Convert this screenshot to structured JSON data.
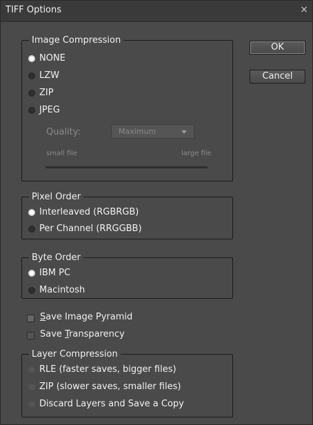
{
  "window": {
    "title": "TIFF Options",
    "close_glyph": "×"
  },
  "buttons": {
    "ok": "OK",
    "cancel": "Cancel"
  },
  "image_compression": {
    "legend": "Image Compression",
    "options": [
      "NONE",
      "LZW",
      "ZIP",
      "JPEG"
    ],
    "selected": "NONE",
    "quality_label": "Quality:",
    "quality_value": "Maximum",
    "small_file_label": "small file",
    "large_file_label": "large file"
  },
  "pixel_order": {
    "legend": "Pixel Order",
    "options": [
      "Interleaved (RGBRGB)",
      "Per Channel (RRGGBB)"
    ],
    "selected": "Interleaved (RGBRGB)"
  },
  "byte_order": {
    "legend": "Byte Order",
    "options": [
      "IBM PC",
      "Macintosh"
    ],
    "selected": "IBM PC"
  },
  "checkboxes": {
    "save_image_pyramid": {
      "mnemonic": "S",
      "rest": "ave Image Pyramid",
      "checked": false
    },
    "save_transparency": {
      "prefix": "Save ",
      "mnemonic": "T",
      "rest": "ransparency",
      "checked": false,
      "disabled": true
    }
  },
  "layer_compression": {
    "legend": "Layer Compression",
    "options": [
      "RLE (faster saves, bigger files)",
      "ZIP (slower saves, smaller files)",
      "Discard Layers and Save a Copy"
    ],
    "disabled": true
  },
  "colors": {
    "dialog_bg": "#4a4a4a",
    "titlebar_bg": "#3a3a3a",
    "text": "#f0f0f0",
    "disabled_text": "#8a8a8a"
  }
}
